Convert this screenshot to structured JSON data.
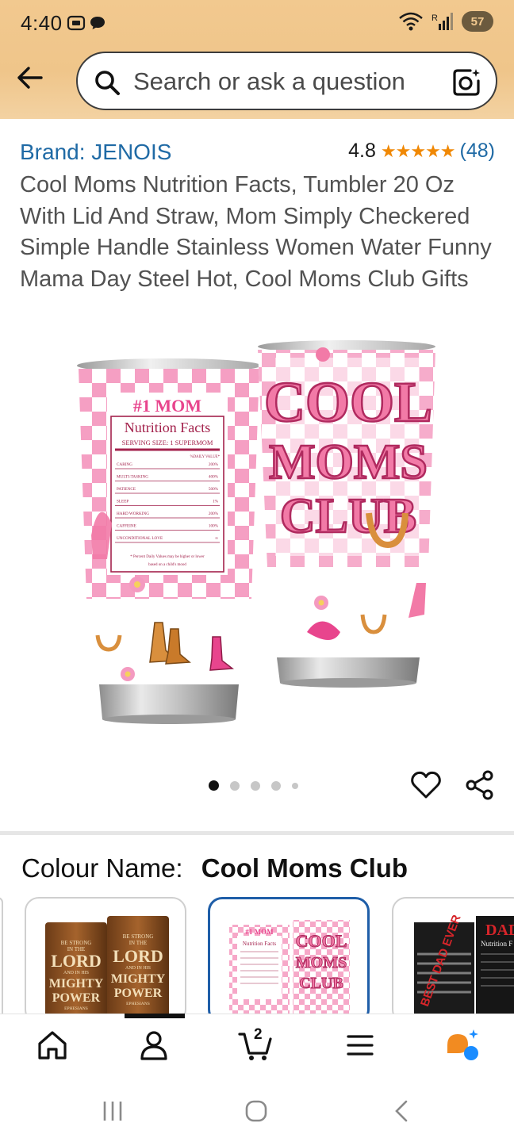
{
  "status_bar": {
    "time": "4:40",
    "battery": "57",
    "signal_label": "R"
  },
  "search": {
    "placeholder": "Search or ask a question"
  },
  "product": {
    "brand": "Brand: JENOIS",
    "rating": "4.8",
    "stars": "★★★★★",
    "review_count": "(48)",
    "title": "Cool Moms Nutrition Facts, Tumbler 20 Oz With Lid And Straw, Mom Simply Checkered Simple Handle Stainless Women Water Funny Mama Day Steel Hot, Cool Moms Club Gifts",
    "image_text": {
      "left_header": "#1 MOM",
      "nutrition_title": "Nutrition Facts",
      "serving_size": "SERVING SIZE: 1 SUPERMOM",
      "daily_value_header": "%DAILY VALUE*",
      "rows": [
        {
          "label": "CARING",
          "value": "200%"
        },
        {
          "label": "MULTI-TASKING",
          "value": "400%"
        },
        {
          "label": "PATIENCE",
          "value": "500%"
        },
        {
          "label": "SLEEP",
          "value": "1%"
        },
        {
          "label": "HARD WORKING",
          "value": "200%"
        },
        {
          "label": "CAFFEINE",
          "value": "100%"
        },
        {
          "label": "UNCONDITIONAL LOVE",
          "value": "∞"
        }
      ],
      "footnote_1": "* Percent Daily Values may be higher or lower",
      "footnote_2": "based on a child's mood",
      "right_line_1": "COOL",
      "right_line_2": "MOMS",
      "right_line_3": "CLUB"
    }
  },
  "carousel": {
    "total": 5,
    "active_index": 0
  },
  "colour": {
    "label": "Colour Name:",
    "value": "Cool Moms Club"
  },
  "swatches": [
    {
      "name": "Lord Mighty Power",
      "l1": "BE STRONG",
      "l2": "IN THE",
      "l3": "LORD",
      "l4": "AND IN HIS",
      "l5": "MIGHTY",
      "l6": "POWER",
      "l7": "EPHESIANS"
    },
    {
      "name": "Cool Moms Club",
      "l1": "#1 MOM",
      "l2": "Nutrition Facts",
      "l3": "COOL",
      "l4": "MOMS",
      "l5": "CLUB"
    },
    {
      "name": "Best Dad Ever",
      "l1": "BEST DAD EVER",
      "l2": "DAD",
      "l3": "Nutrition F"
    }
  ],
  "bottom_nav": {
    "cart_count": "2"
  },
  "colors": {
    "accent_link": "#1f6aa5",
    "star": "#f08804",
    "header_bg": "#f2c98f",
    "pink": "#f27aa7",
    "selected_border": "#1f5ea8"
  }
}
